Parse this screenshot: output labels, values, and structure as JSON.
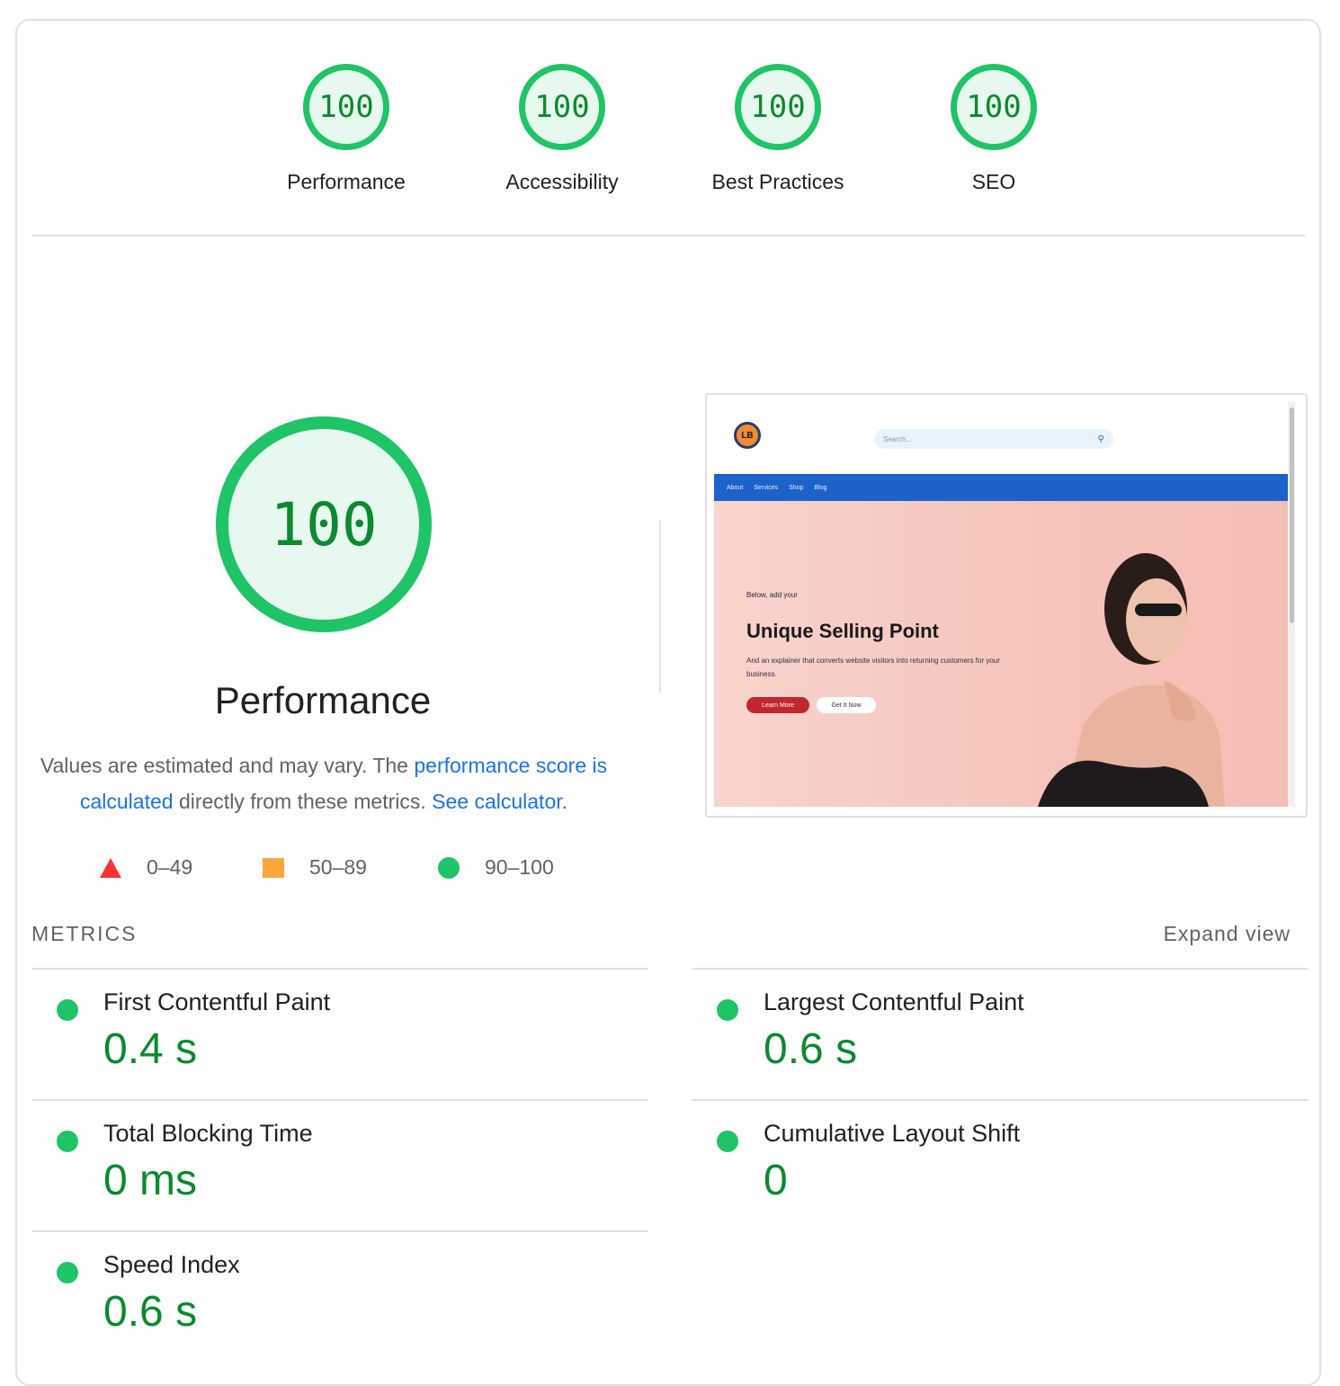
{
  "categories": [
    {
      "score": "100",
      "label": "Performance"
    },
    {
      "score": "100",
      "label": "Accessibility"
    },
    {
      "score": "100",
      "label": "Best Practices"
    },
    {
      "score": "100",
      "label": "SEO"
    }
  ],
  "main": {
    "score": "100",
    "title": "Performance",
    "desc_prefix": "Values are estimated and may vary. The ",
    "desc_link1": "performance score is calculated",
    "desc_middle": " directly from these metrics. ",
    "desc_link2": "See calculator."
  },
  "legend": {
    "fail": "0–49",
    "average": "50–89",
    "pass": "90–100"
  },
  "preview": {
    "logo_text": "LB",
    "search_placeholder": "Search...",
    "nav": [
      "About",
      "Services",
      "Shop",
      "Blog"
    ],
    "hero_small": "Below, add your",
    "hero_headline": "Unique Selling Point",
    "hero_sub": "And an explainer that converts website visitors into returning customers for your business.",
    "btn_primary": "Learn More",
    "btn_secondary": "Get It Now"
  },
  "metrics": {
    "title": "METRICS",
    "expand": "Expand view",
    "items": [
      {
        "name": "First Contentful Paint",
        "value": "0.4 s"
      },
      {
        "name": "Largest Contentful Paint",
        "value": "0.6 s"
      },
      {
        "name": "Total Blocking Time",
        "value": "0 ms"
      },
      {
        "name": "Cumulative Layout Shift",
        "value": "0"
      },
      {
        "name": "Speed Index",
        "value": "0.6 s"
      }
    ]
  },
  "colors": {
    "pass": "#1fc466",
    "pass_text": "#0b8a2e",
    "average": "#ffa63d",
    "fail": "#ff3333",
    "link": "#1a73e8"
  }
}
